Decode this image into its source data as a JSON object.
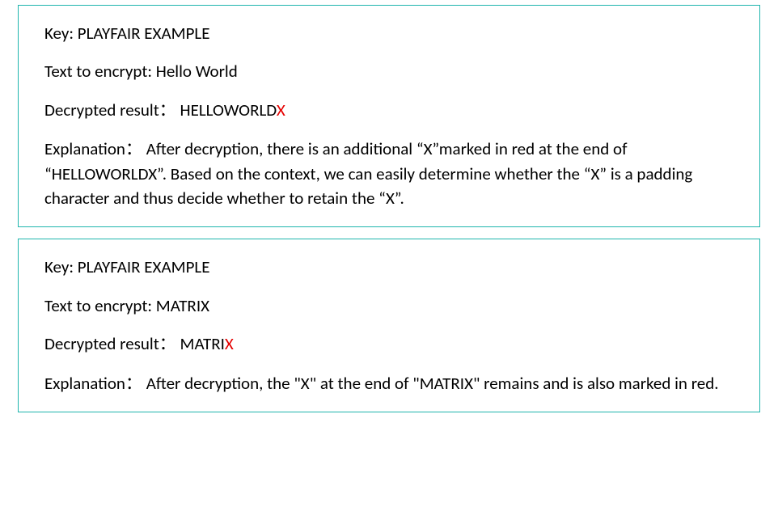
{
  "box1": {
    "keyLabel": "Key: ",
    "keyValue": "PLAYFAIR EXAMPLE",
    "textLabel": "Text to encrypt: ",
    "textValue": "Hello World",
    "decryptedLabel": "Decrypted result",
    "decryptedValuePrefix": "HELLOWORLD",
    "decryptedValueRed": "X",
    "explanationLabel": "Explanation",
    "explanationText": "After decryption, there is an additional “X”marked in red at the end of “HELLOWORLDX”. Based on the context, we can easily determine whether the “X” is a padding character and thus decide whether to retain the “X”."
  },
  "box2": {
    "keyLabel": "Key: ",
    "keyValue": "PLAYFAIR EXAMPLE",
    "textLabel": "Text to encrypt: ",
    "textValue": "MATRIX",
    "decryptedLabel": "Decrypted result",
    "decryptedValuePrefix": "MATRI",
    "decryptedValueRed": "X",
    "explanationLabel": "Explanation",
    "explanationText": "After decryption, the \"X\" at the end of \"MATRIX\" remains and is also marked in red."
  }
}
